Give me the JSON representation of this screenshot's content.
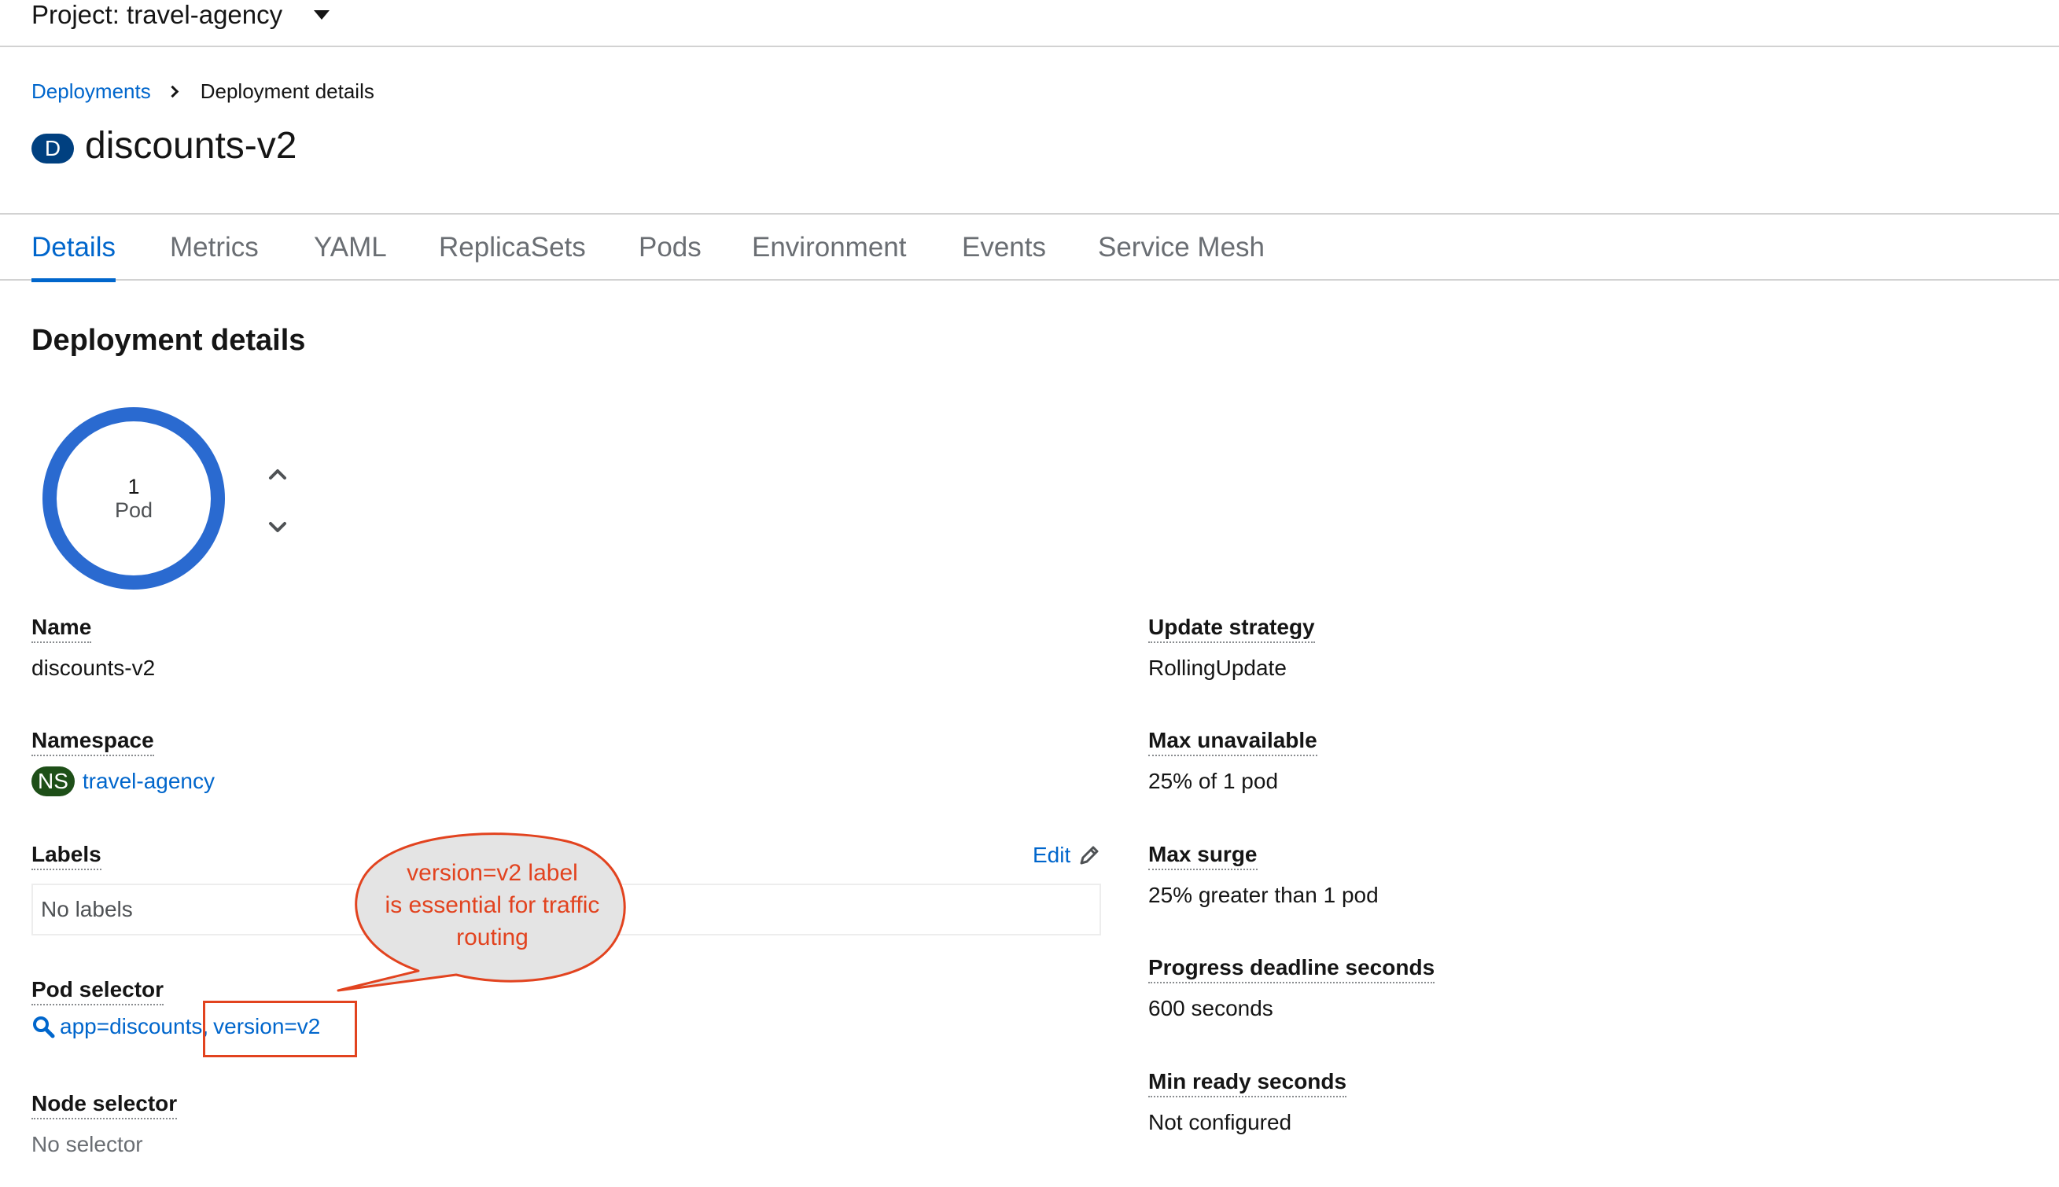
{
  "project": {
    "label": "Project: travel-agency"
  },
  "breadcrumb": {
    "parent": "Deployments",
    "current": "Deployment details"
  },
  "resource": {
    "badge": "D",
    "title": "discounts-v2"
  },
  "tabs": [
    {
      "label": "Details",
      "active": true
    },
    {
      "label": "Metrics",
      "active": false
    },
    {
      "label": "YAML",
      "active": false
    },
    {
      "label": "ReplicaSets",
      "active": false
    },
    {
      "label": "Pods",
      "active": false
    },
    {
      "label": "Environment",
      "active": false
    },
    {
      "label": "Events",
      "active": false
    },
    {
      "label": "Service Mesh",
      "active": false
    }
  ],
  "section": {
    "title": "Deployment details"
  },
  "pods": {
    "count": "1",
    "unit": "Pod",
    "ring_color": "#2a6ad0"
  },
  "details_left": {
    "name": {
      "label": "Name",
      "value": "discounts-v2"
    },
    "namespace": {
      "label": "Namespace",
      "badge": "NS",
      "value": "travel-agency"
    },
    "labels": {
      "label": "Labels",
      "edit": "Edit",
      "empty": "No labels"
    },
    "pod_selector": {
      "label": "Pod selector",
      "part1": "app=discounts,",
      "part2": "version=v2"
    },
    "node_selector": {
      "label": "Node selector",
      "value": "No selector"
    }
  },
  "details_right": {
    "update_strategy": {
      "label": "Update strategy",
      "value": "RollingUpdate"
    },
    "max_unavailable": {
      "label": "Max unavailable",
      "value": "25% of 1 pod"
    },
    "max_surge": {
      "label": "Max surge",
      "value": "25% greater than 1 pod"
    },
    "progress_deadline": {
      "label": "Progress deadline seconds",
      "value": "600 seconds"
    },
    "min_ready": {
      "label": "Min ready seconds",
      "value": "Not configured"
    }
  },
  "annotation": {
    "line1": "version=v2 label",
    "line2": "is essential for traffic",
    "line3": "routing",
    "color": "#e2431f"
  }
}
